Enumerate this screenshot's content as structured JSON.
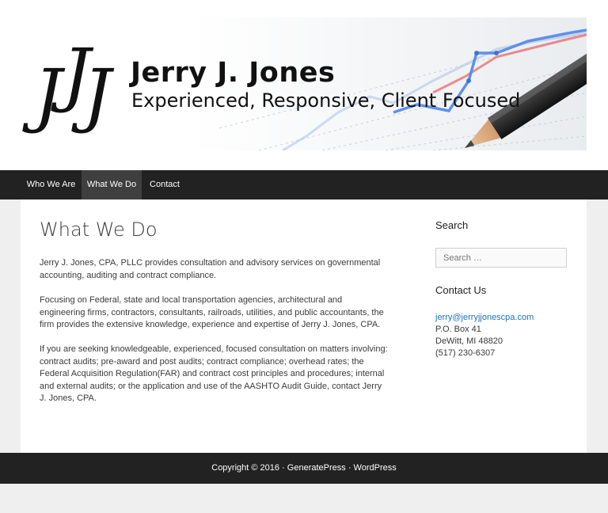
{
  "header": {
    "brand_name": "Jerry J. Jones",
    "tagline": "Experienced, Responsive, Client Focused",
    "logo_letters": "JJJ"
  },
  "nav": {
    "items": [
      {
        "label": "Who We Are",
        "active": false
      },
      {
        "label": "What We Do",
        "active": true
      },
      {
        "label": "Contact",
        "active": false
      }
    ]
  },
  "main": {
    "title": "What We Do",
    "paragraphs": [
      "Jerry J. Jones, CPA, PLLC provides consultation and advisory services on governmental accounting, auditing and contract compliance.",
      "Focusing on Federal, state and local transportation agencies, architectural and engineering firms, contractors, consultants, railroads, utilities, and public accountants, the firm provides the extensive knowledge, experience and expertise of Jerry J. Jones, CPA.",
      "If you are seeking knowledgeable, experienced, focused consultation on matters involving: contract audits; pre-award and post audits; contract compliance; overhead rates; the Federal Acquisition Regulation(FAR) and contract cost principles and procedures; internal and external audits; or the application and use of the AASHTO Audit Guide, contact Jerry J. Jones, CPA."
    ]
  },
  "sidebar": {
    "search_heading": "Search",
    "search_placeholder": "Search …",
    "contact_heading": "Contact Us",
    "email": "jerry@jerryjjonescpa.com",
    "po_box": "P.O. Box 41",
    "city": "DeWitt, MI 48820",
    "phone": "(517) 230-6307"
  },
  "footer": {
    "text": "Copyright © 2016 · GeneratePress · WordPress"
  },
  "colors": {
    "nav_bg": "#222222",
    "nav_active_bg": "#3f3f3f",
    "link": "#1e73be",
    "page_bg": "#efefef"
  }
}
